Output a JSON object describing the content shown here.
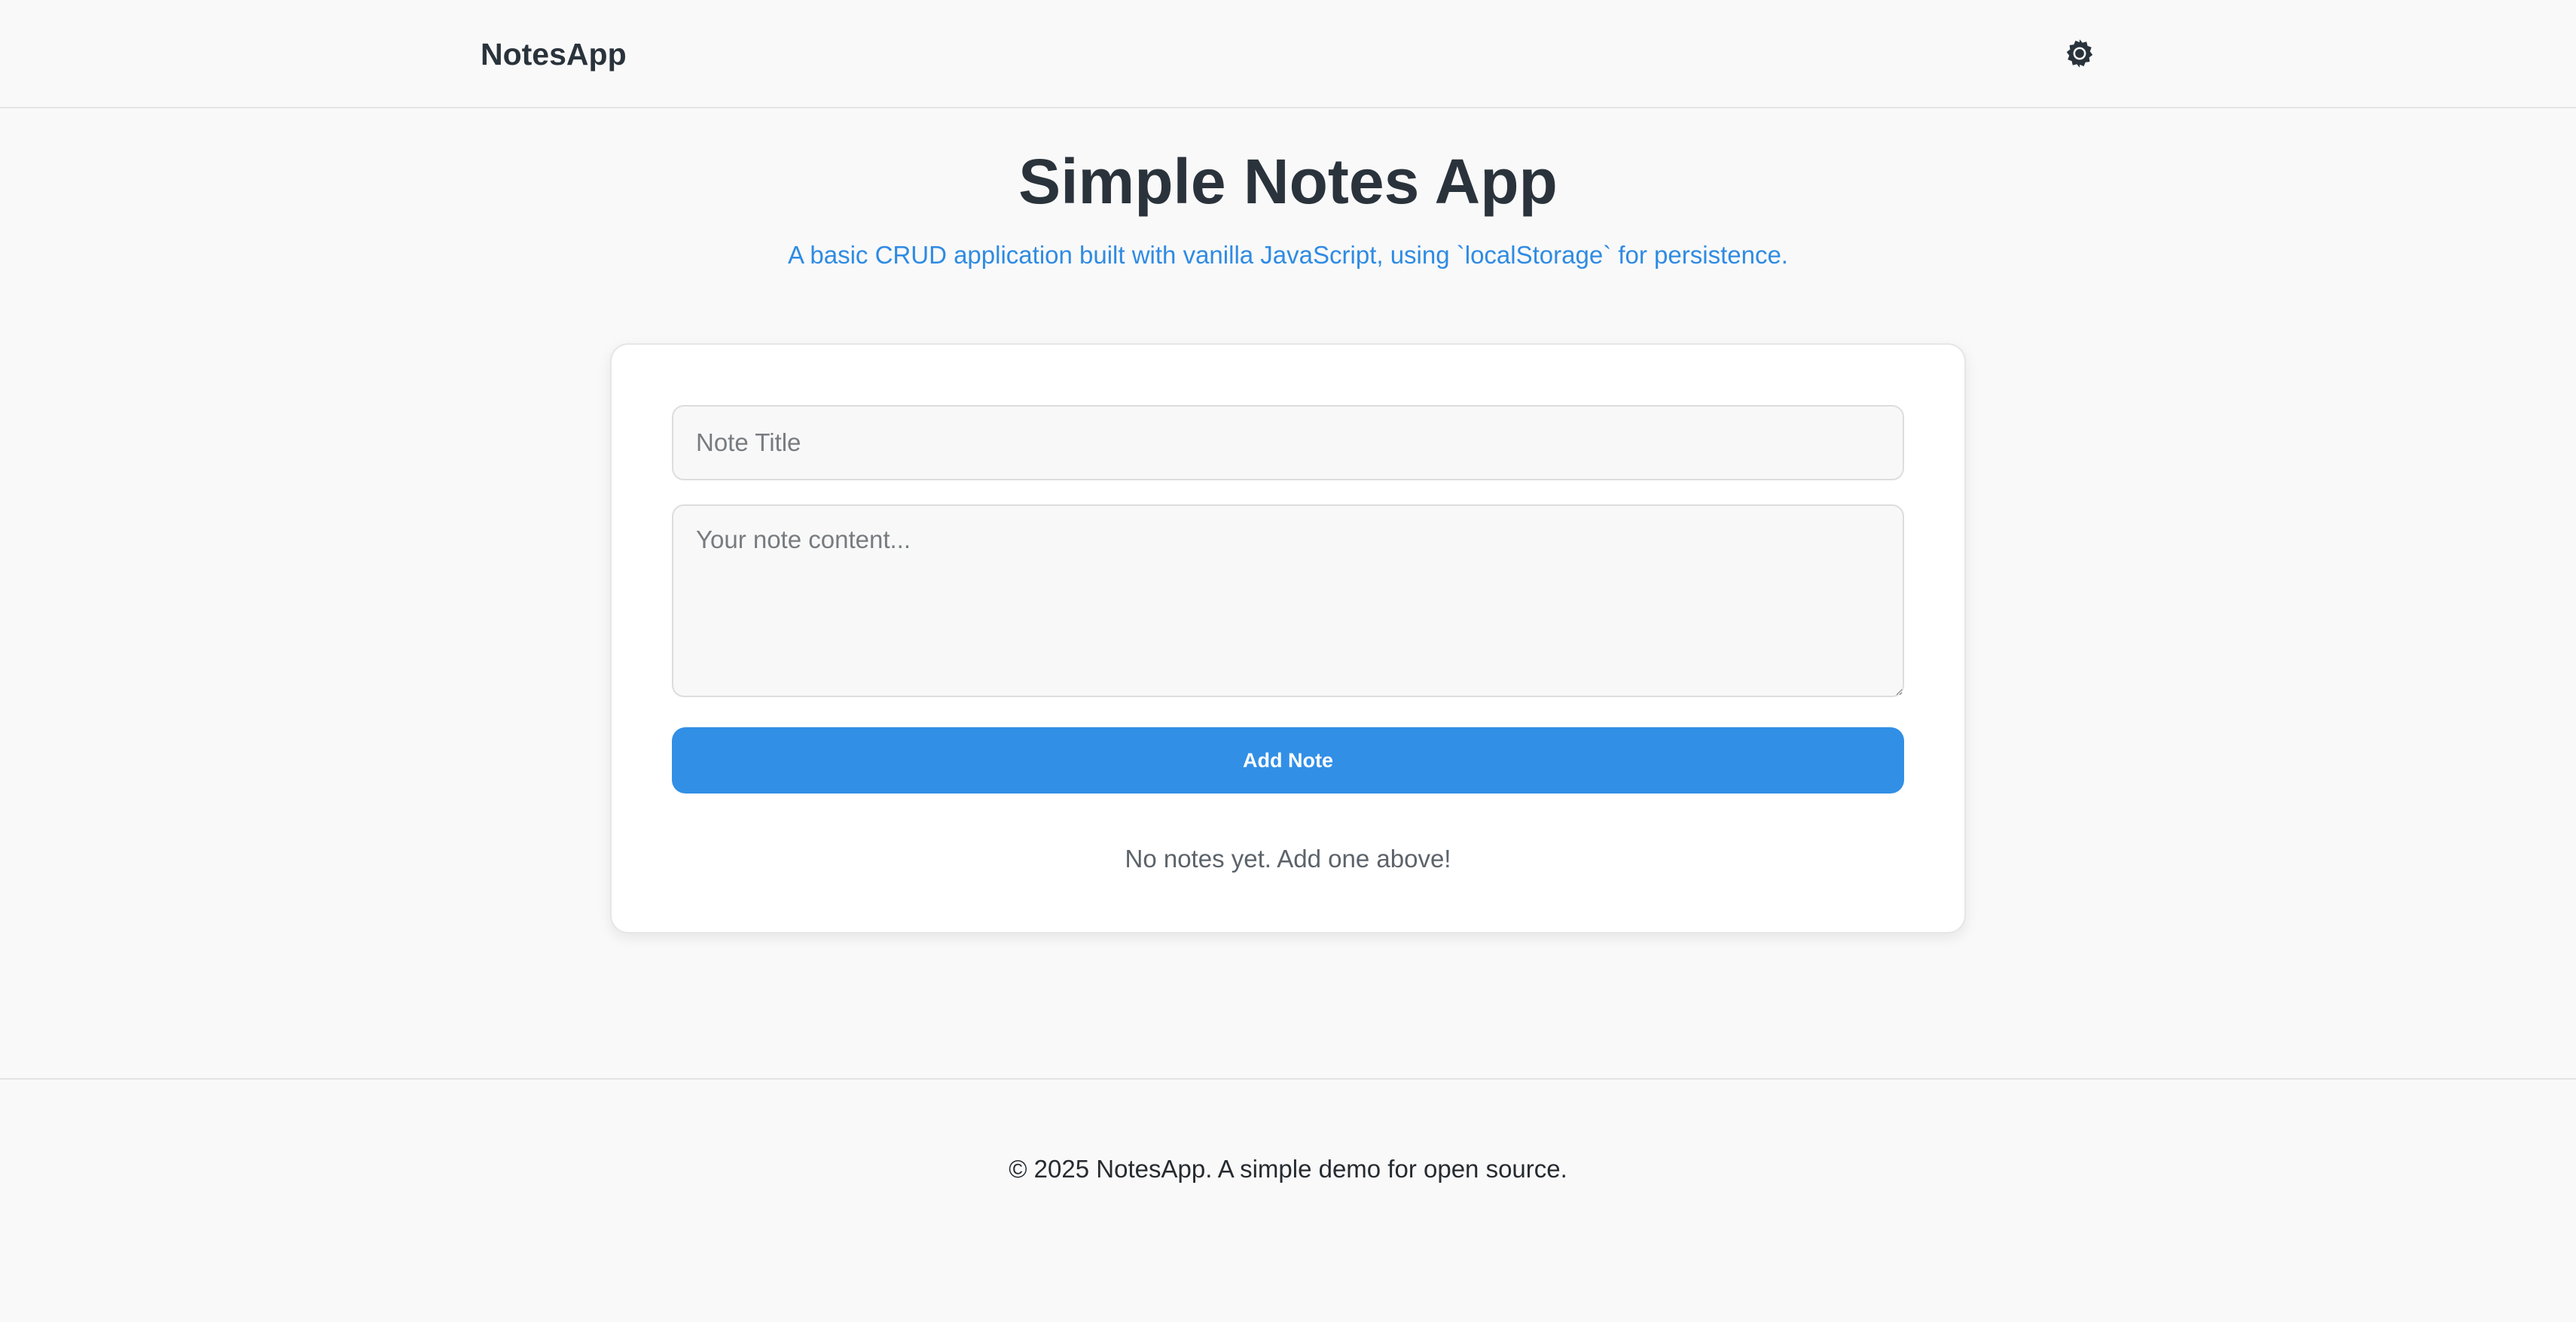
{
  "header": {
    "brand": "NotesApp",
    "theme_toggle_icon": "gear-icon"
  },
  "main": {
    "title": "Simple Notes App",
    "subtitle": "A basic CRUD application built with vanilla JavaScript, using `localStorage` for persistence."
  },
  "form": {
    "title_placeholder": "Note Title",
    "title_value": "",
    "content_placeholder": "Your note content...",
    "content_value": "",
    "add_label": "Add Note"
  },
  "notes": {
    "empty_message": "No notes yet. Add one above!"
  },
  "footer": {
    "text": "© 2025 NotesApp. A simple demo for open source."
  },
  "colors": {
    "accent": "#318fe6",
    "subtitle": "#2f8be3",
    "background": "#f9f9f9",
    "text": "#2a333b"
  }
}
